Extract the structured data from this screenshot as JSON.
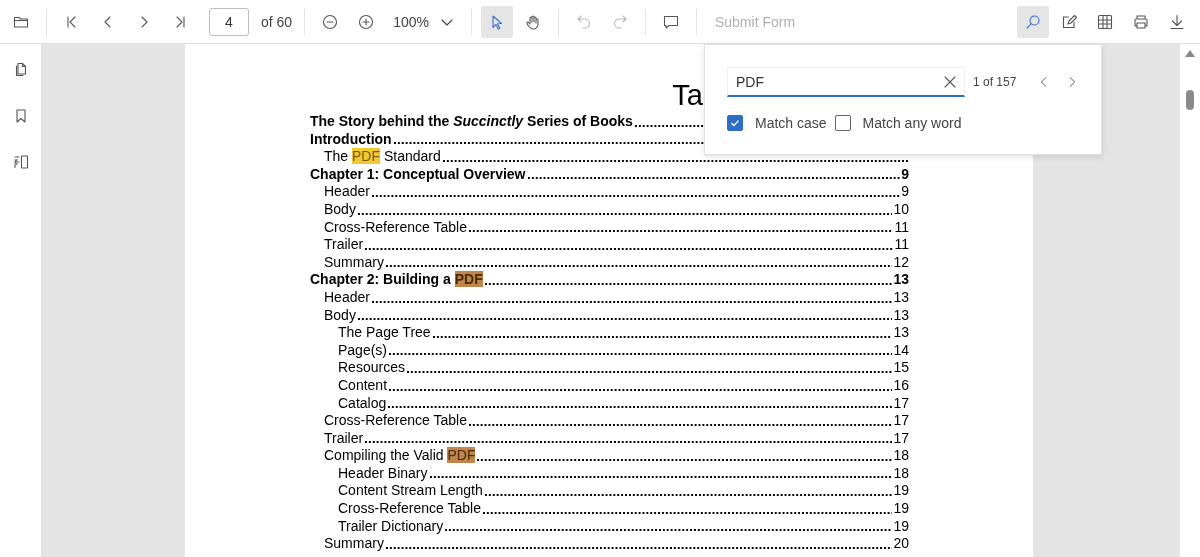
{
  "toolbar": {
    "left": [
      {
        "kind": "open",
        "selected": false,
        "disabled": false
      },
      {
        "kind": "separator"
      },
      {
        "kind": "first",
        "selected": false,
        "disabled": false
      },
      {
        "kind": "prev",
        "selected": false,
        "disabled": false
      },
      {
        "kind": "next",
        "selected": false,
        "disabled": false
      },
      {
        "kind": "last",
        "selected": false,
        "disabled": false
      },
      {
        "kind": "page_input",
        "value": "4",
        "label": "of 60"
      },
      {
        "kind": "separator"
      },
      {
        "kind": "zoom_out",
        "selected": false,
        "disabled": false
      },
      {
        "kind": "zoom_in",
        "selected": false,
        "disabled": false
      },
      {
        "kind": "zoom_select",
        "value": "100%"
      },
      {
        "kind": "separator"
      },
      {
        "kind": "select",
        "selected": true,
        "disabled": false
      },
      {
        "kind": "pan",
        "selected": false,
        "disabled": false
      },
      {
        "kind": "separator"
      },
      {
        "kind": "undo",
        "selected": false,
        "disabled": true
      },
      {
        "kind": "redo",
        "selected": false,
        "disabled": true
      },
      {
        "kind": "separator"
      },
      {
        "kind": "comment",
        "selected": false,
        "disabled": false
      },
      {
        "kind": "separator"
      },
      {
        "kind": "text_button",
        "label": "Submit Form",
        "disabled": true
      }
    ],
    "right": [
      {
        "kind": "search",
        "selected": true,
        "disabled": false
      },
      {
        "kind": "edit",
        "selected": false,
        "disabled": false
      },
      {
        "kind": "form",
        "selected": false,
        "disabled": false
      },
      {
        "kind": "print",
        "selected": false,
        "disabled": false
      },
      {
        "kind": "download",
        "selected": false,
        "disabled": false
      }
    ]
  },
  "sidebar": {
    "items": [
      {
        "kind": "pages"
      },
      {
        "kind": "bookmark"
      },
      {
        "kind": "organize"
      }
    ]
  },
  "document": {
    "title": "Ta",
    "entries": [
      {
        "bold": true,
        "title": [
          {
            "text": "The Story behind the *Succinctly* Series of Books"
          }
        ]
      },
      {
        "bold": true,
        "title": [
          {
            "text": "Introduction"
          }
        ],
        "children": [
          {
            "bold": false,
            "title": [
              {
                "text": "The "
              },
              {
                "text": "PDF",
                "highlight": true,
                "current": true
              },
              {
                "text": " Standard"
              }
            ]
          }
        ]
      },
      {
        "bold": true,
        "title": [
          {
            "text": "Chapter 1: Conceptual Overview"
          }
        ],
        "page": "9",
        "children": [
          {
            "bold": false,
            "title": [
              {
                "text": "Header"
              }
            ],
            "page": "9"
          },
          {
            "bold": false,
            "title": [
              {
                "text": "Body"
              }
            ],
            "page": "10"
          },
          {
            "bold": false,
            "title": [
              {
                "text": "Cross-Reference Table"
              }
            ],
            "page": "11"
          },
          {
            "bold": false,
            "title": [
              {
                "text": "Trailer"
              }
            ],
            "page": "11"
          },
          {
            "bold": false,
            "title": [
              {
                "text": "Summary"
              }
            ],
            "page": "12"
          }
        ]
      },
      {
        "bold": true,
        "title": [
          {
            "text": "Chapter 2: Building a "
          },
          {
            "text": "PDF",
            "highlight": true,
            "current": false
          }
        ],
        "page": "13",
        "children": [
          {
            "bold": false,
            "title": [
              {
                "text": "Header"
              }
            ],
            "page": "13"
          },
          {
            "bold": false,
            "title": [
              {
                "text": "Body"
              }
            ],
            "page": "13",
            "children": [
              {
                "bold": false,
                "title": [
                  {
                    "text": "The Page Tree"
                  }
                ],
                "page": "13"
              },
              {
                "bold": false,
                "title": [
                  {
                    "text": "Page(s)"
                  }
                ],
                "page": "14"
              },
              {
                "bold": false,
                "title": [
                  {
                    "text": "Resources"
                  }
                ],
                "page": "15"
              },
              {
                "bold": false,
                "title": [
                  {
                    "text": "Content"
                  }
                ],
                "page": "16"
              },
              {
                "bold": false,
                "title": [
                  {
                    "text": "Catalog"
                  }
                ],
                "page": "17"
              }
            ]
          },
          {
            "bold": false,
            "title": [
              {
                "text": "Cross-Reference Table"
              }
            ],
            "page": "17"
          },
          {
            "bold": false,
            "title": [
              {
                "text": "Trailer"
              }
            ],
            "page": "17"
          },
          {
            "bold": false,
            "title": [
              {
                "text": "Compiling the Valid "
              },
              {
                "text": "PDF",
                "highlight": true,
                "current": false
              }
            ],
            "page": "18",
            "children": [
              {
                "bold": false,
                "title": [
                  {
                    "text": "Header Binary"
                  }
                ],
                "page": "18"
              },
              {
                "bold": false,
                "title": [
                  {
                    "text": "Content Stream Length"
                  }
                ],
                "page": "19"
              },
              {
                "bold": false,
                "title": [
                  {
                    "text": "Cross-Reference Table"
                  }
                ],
                "page": "19"
              },
              {
                "bold": false,
                "title": [
                  {
                    "text": "Trailer Dictionary"
                  }
                ],
                "page": "19"
              }
            ]
          },
          {
            "bold": false,
            "title": [
              {
                "text": "Summary"
              }
            ],
            "page": "20"
          }
        ]
      }
    ]
  },
  "search_panel": {
    "value": "PDF",
    "count": "1 of 157",
    "options": [
      {
        "label": "Match case",
        "checked": true
      },
      {
        "label": "Match any word",
        "checked": false
      }
    ]
  }
}
